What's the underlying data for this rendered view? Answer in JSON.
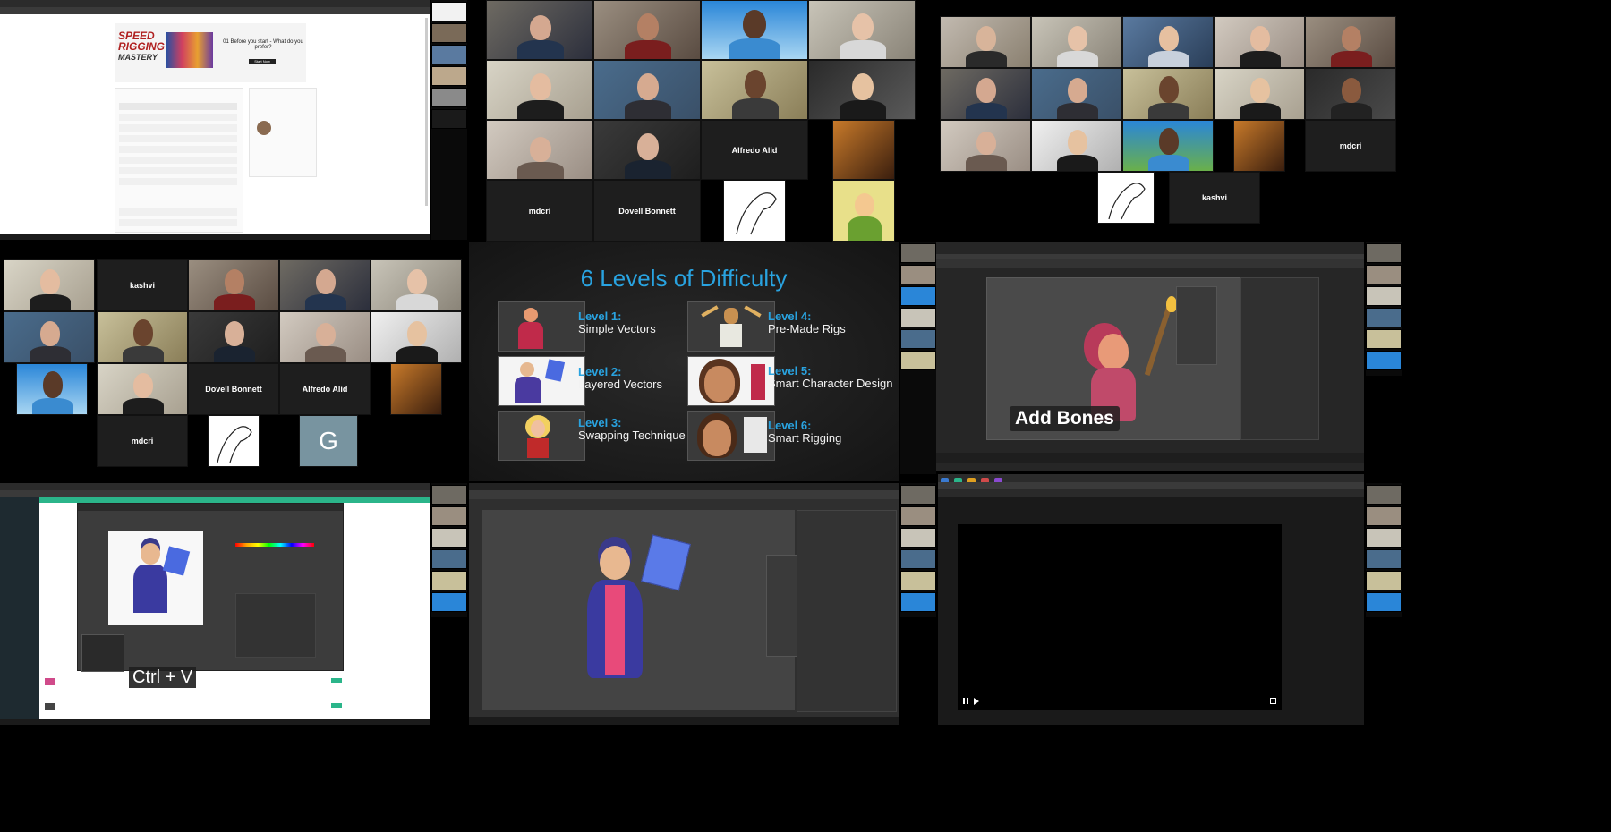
{
  "top_left": {
    "ad_logo_line1": "SPEED",
    "ad_logo_line2": "RIGGING",
    "ad_logo_line3": "MASTERY",
    "ad_question": "01 Before you start - What do you prefer?",
    "ad_button": "Start Now"
  },
  "gallery_a": {
    "names": [
      "Alfredo Alid",
      "mdcri",
      "Dovell Bonnett"
    ]
  },
  "gallery_b": {
    "names": [
      "mdcri",
      "kashvi"
    ]
  },
  "gallery_c": {
    "names": [
      "kashvi",
      "Dovell Bonnett",
      "Alfredo Alid",
      "mdcri"
    ],
    "avatar_letter": "G"
  },
  "slide": {
    "title": "6 Levels of Difficulty",
    "levels": [
      {
        "title": "Level 1:",
        "desc": "Simple Vectors"
      },
      {
        "title": "Level 2:",
        "desc": "Layered Vectors"
      },
      {
        "title": "Level 3:",
        "desc": "Swapping Technique"
      },
      {
        "title": "Level 4:",
        "desc": "Pre-Made Rigs"
      },
      {
        "title": "Level 5:",
        "desc": "Smart Character Design"
      },
      {
        "title": "Level 6:",
        "desc": "Smart Rigging"
      }
    ]
  },
  "rig_panel": {
    "caption": "Add Bones"
  },
  "photoshop_panel": {
    "caption": "Ctrl + V"
  },
  "colors": {
    "accent": "#29a3e0",
    "slide_bg": "#1c1c1c",
    "app_bg": "#2f2f2f"
  }
}
